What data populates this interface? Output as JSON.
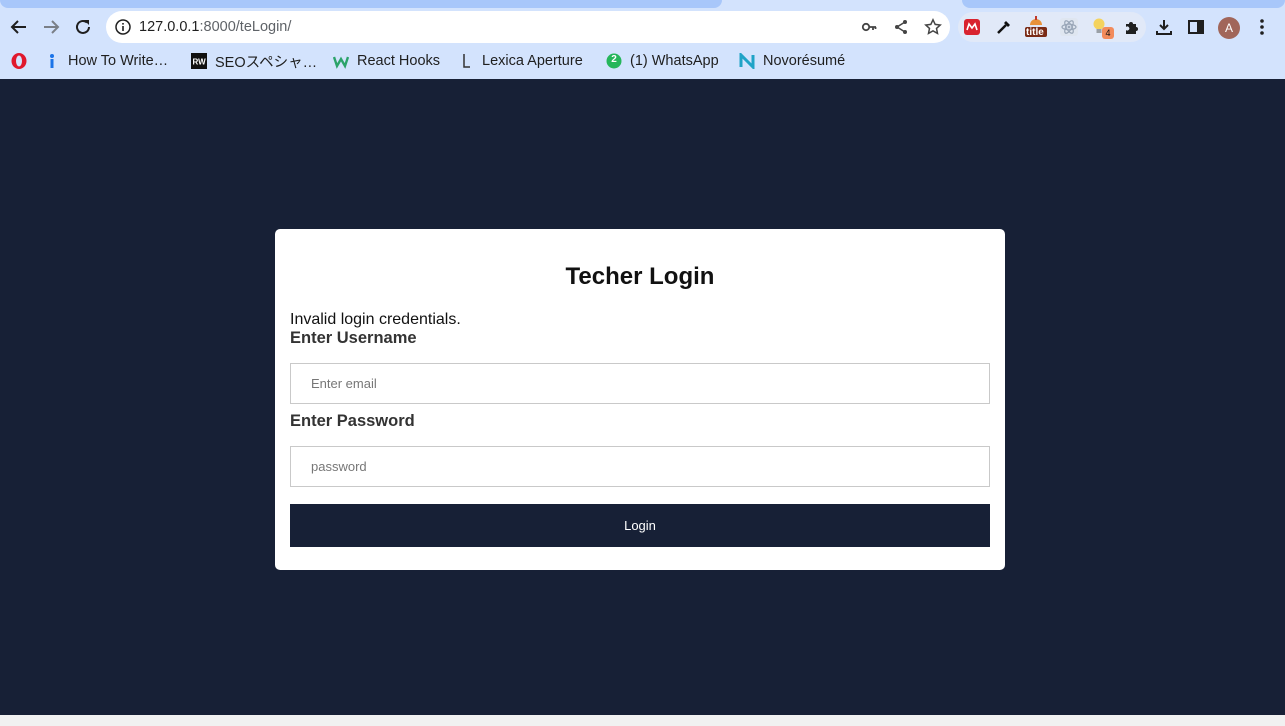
{
  "browser": {
    "url_host": "127.0.0.1",
    "url_path": ":8000/teLogin/",
    "profile_initial": "A",
    "extensions": {
      "tag_badge": "title",
      "bulb_badge": "4"
    },
    "bookmarks": [
      {
        "label": "How To Write…",
        "icon": "info-pin-icon"
      },
      {
        "label": "SEOスペシャ…",
        "icon": "rw-icon"
      },
      {
        "label": "React Hooks",
        "icon": "w-logo-icon"
      },
      {
        "label": "Lexica Aperture",
        "icon": "lexica-icon"
      },
      {
        "label": "(1) WhatsApp",
        "icon": "whatsapp-icon",
        "badge": "2"
      },
      {
        "label": "Novorésumé",
        "icon": "novoresume-icon"
      }
    ]
  },
  "login": {
    "title": "Techer Login",
    "message": "Invalid login credentials.",
    "username_label": "Enter Username",
    "username_placeholder": "Enter email",
    "password_label": "Enter Password",
    "password_placeholder": "password",
    "button_label": "Login"
  },
  "colors": {
    "page_bg": "#172036",
    "card_bg": "#ffffff",
    "button_bg": "#172036",
    "chrome_bg": "#d3e3fd"
  }
}
